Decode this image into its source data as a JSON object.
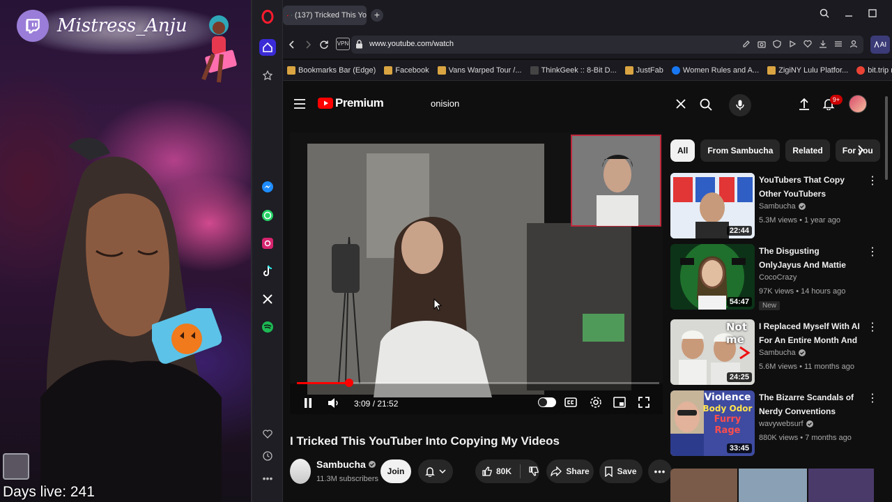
{
  "overlay": {
    "streamer_name": "Mistress_Anju",
    "days_live": "Days live: 241"
  },
  "browser": {
    "tab_title": "(137) Tricked This Yo",
    "url": "www.youtube.com/watch",
    "vpn_label": "VPN",
    "ai_label": "AI",
    "bookmarks": [
      {
        "label": "Bookmarks Bar (Edge)",
        "color": "#d9a441"
      },
      {
        "label": "Facebook",
        "color": "#d9a441"
      },
      {
        "label": "Vans Warped Tour /...",
        "color": "#d9a441"
      },
      {
        "label": "ThinkGeek :: 8-Bit D...",
        "color": "#444444"
      },
      {
        "label": "JustFab",
        "color": "#d9a441"
      },
      {
        "label": "Women Rules and A...",
        "color": "#1877f2"
      },
      {
        "label": "ZigiNY Lulu Platfor...",
        "color": "#d9a441"
      },
      {
        "label": "bit.trip runner free...",
        "color": "#ea4335"
      }
    ]
  },
  "youtube": {
    "logo_label": "Premium",
    "search_value": "onision",
    "notification_count": "9+",
    "chips": [
      "All",
      "From Sambucha",
      "Related",
      "For you"
    ],
    "player": {
      "time": "3:09 / 21:52",
      "progress": 0.144
    },
    "video": {
      "title": "I Tricked This YouTuber Into Copying My Videos",
      "channel": "Sambucha",
      "subscribers": "11.3M subscribers",
      "join_label": "Join",
      "likes": "80K",
      "share_label": "Share",
      "save_label": "Save"
    },
    "recommendations": [
      {
        "title": "YouTubers That Copy Other YouTubers",
        "channel": "Sambucha",
        "verified": true,
        "meta": "5.3M views • 1 year ago",
        "duration": "22:44",
        "badge": ""
      },
      {
        "title": "The Disgusting OnlyJayus And Mattie Westbrouck Situation (...",
        "channel": "CocoCrazy",
        "verified": false,
        "meta": "97K views • 14 hours ago",
        "duration": "54:47",
        "badge": "New"
      },
      {
        "title": "I Replaced Myself With AI For An Entire Month And Nobody ...",
        "channel": "Sambucha",
        "verified": true,
        "meta": "5.6M views • 11 months ago",
        "duration": "24:25",
        "badge": ""
      },
      {
        "title": "The Bizarre Scandals of Nerdy Conventions",
        "channel": "wavywebsurf",
        "verified": true,
        "meta": "880K views • 7 months ago",
        "duration": "33:45",
        "badge": ""
      }
    ],
    "thumb4_text": [
      "Violence",
      "Body Odor",
      "Furry Rage"
    ],
    "thumb3_text": "Not me"
  }
}
